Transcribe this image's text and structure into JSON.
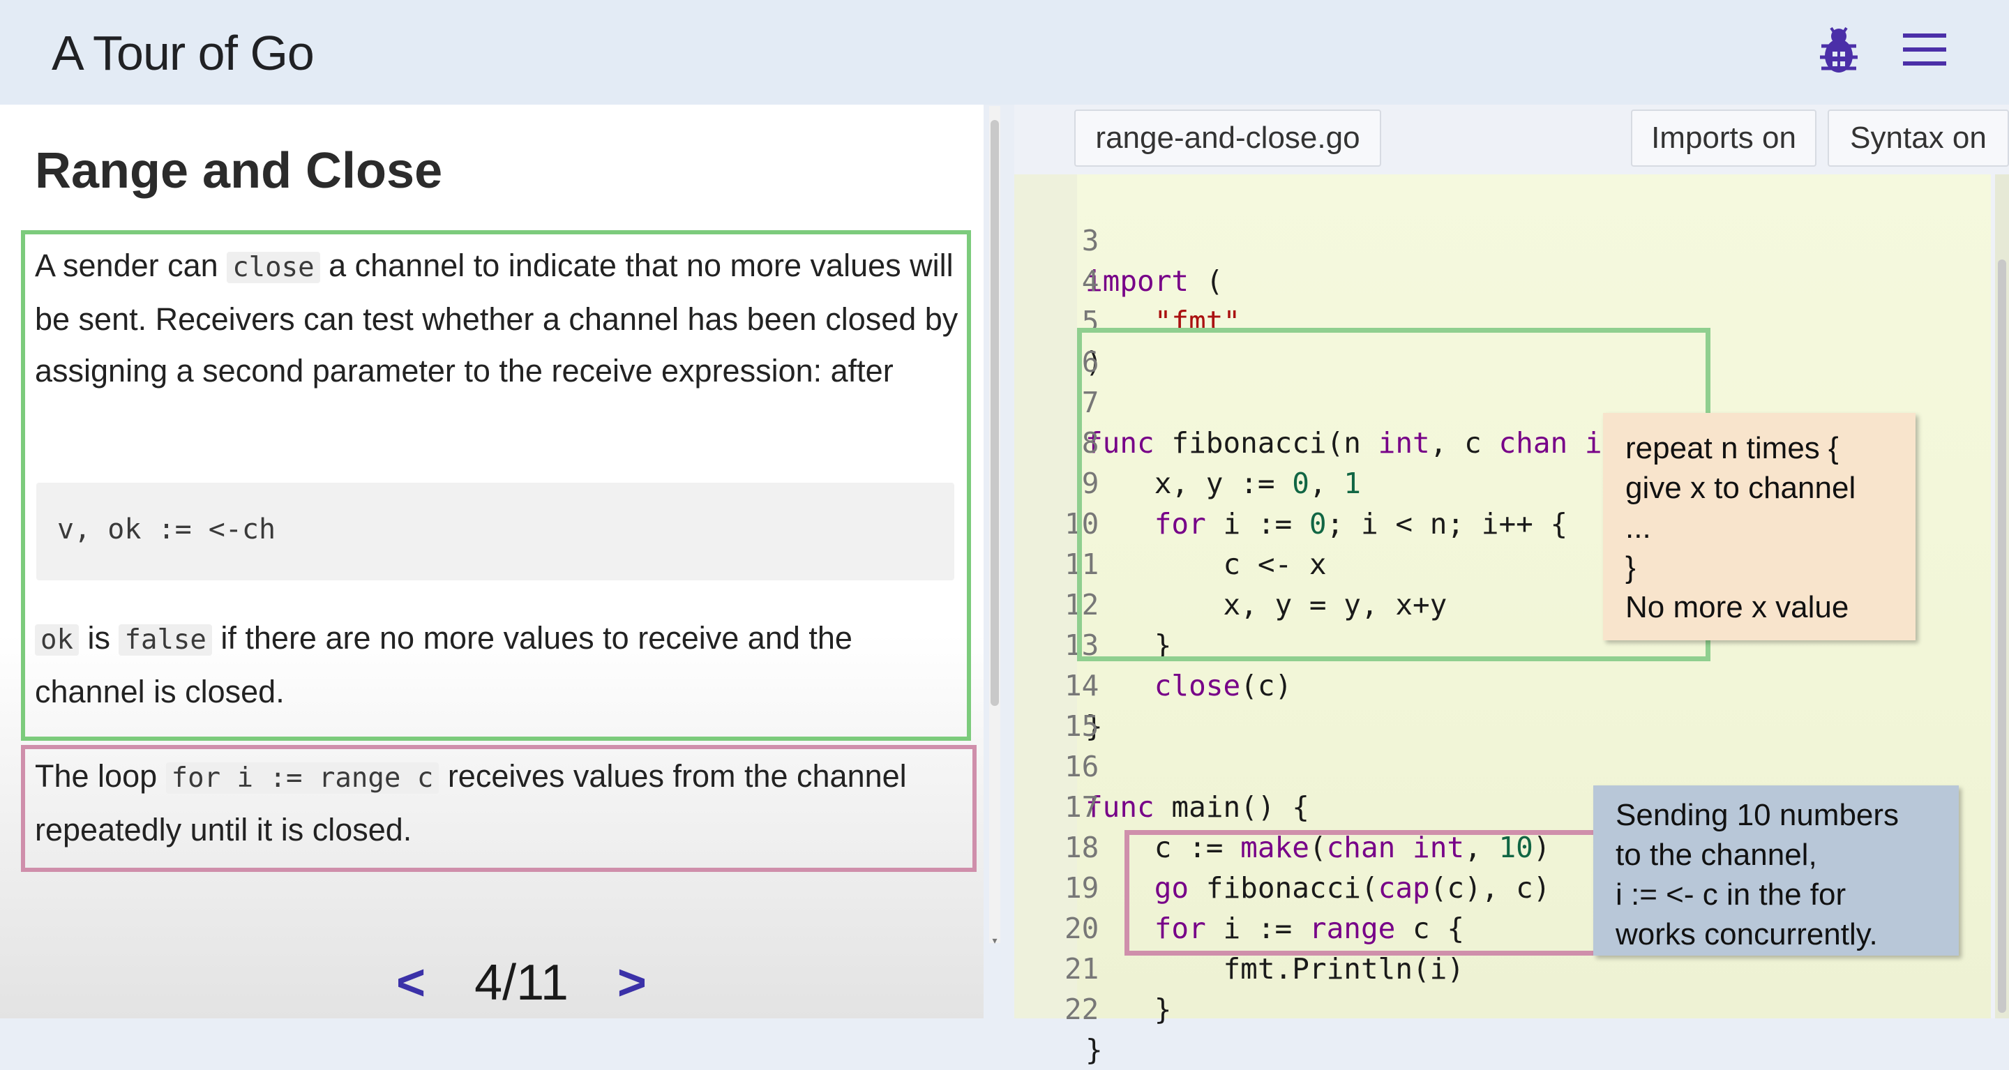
{
  "header": {
    "title": "A Tour of Go",
    "icons": [
      "bug-icon",
      "menu-icon"
    ],
    "accent_color": "#3b31a8"
  },
  "lesson": {
    "title": "Range and Close",
    "p1": {
      "t1": "A sender can ",
      "c1": "close",
      "t2": " a channel to indicate that no more values will be sent. Receivers can test whether a channel has been closed by assigning a second parameter to the receive expression: after"
    },
    "code_block": "v, ok := <-ch",
    "p2": {
      "c1": "ok",
      "t1": " is ",
      "c2": "false",
      "t2": " if there are no more values to receive and the channel is closed."
    },
    "p3": {
      "t1": "The loop ",
      "c1": "for i := range c",
      "t2": " receives values from the channel repeatedly until it is closed."
    }
  },
  "pager": {
    "prev": "<",
    "label": "4/11",
    "next": ">"
  },
  "editor": {
    "file_tab": "range-and-close.go",
    "imports_button": "Imports on",
    "syntax_button": "Syntax on"
  },
  "code": {
    "l3": {
      "n": "3",
      "a": "import",
      "b": " ("
    },
    "l4": {
      "n": "4",
      "a": "    ",
      "b": "\"fmt\""
    },
    "l5": {
      "n": "5",
      "a": ")"
    },
    "l6": {
      "n": "6"
    },
    "l7": {
      "n": "7",
      "a": "func",
      "b": " fibonacci(n ",
      "c": "int",
      "d": ", c ",
      "e": "chan",
      "f": " ",
      "g": "int",
      "h": ") {"
    },
    "l8": {
      "n": "8",
      "a": "    x, y := ",
      "b": "0",
      "c": ", ",
      "d": "1"
    },
    "l9": {
      "n": "9",
      "a": "    ",
      "b": "for",
      "c": " i := ",
      "d": "0",
      "e": "; i < n; i++ {"
    },
    "l10": {
      "n": "10",
      "a": "        c <- x"
    },
    "l11": {
      "n": "11",
      "a": "        x, y = y, x+y"
    },
    "l12": {
      "n": "12",
      "a": "    }"
    },
    "l13": {
      "n": "13",
      "a": "    ",
      "b": "close",
      "c": "(c)"
    },
    "l14": {
      "n": "14",
      "a": "}"
    },
    "l15": {
      "n": "15"
    },
    "l16": {
      "n": "16",
      "a": "func",
      "b": " main() {"
    },
    "l17": {
      "n": "17",
      "a": "    c := ",
      "b": "make",
      "c": "(",
      "d": "chan",
      "e": " ",
      "f": "int",
      "g": ", ",
      "h": "10",
      "i": ")"
    },
    "l18": {
      "n": "18",
      "a": "    ",
      "b": "go",
      "c": " fibonacci(",
      "d": "cap",
      "e": "(c), c)"
    },
    "l19": {
      "n": "19",
      "a": "    ",
      "b": "for",
      "c": " i := ",
      "d": "range",
      "e": " c {"
    },
    "l20": {
      "n": "20",
      "a": "        fmt.Println(i)"
    },
    "l21": {
      "n": "21",
      "a": "    }"
    },
    "l22": {
      "n": "22",
      "a": "}"
    }
  },
  "annotations": {
    "orange_note": [
      "repeat n times {",
      "give x to channel",
      "...",
      "}",
      "No more x value"
    ],
    "blue_note": [
      "Sending 10 numbers",
      "to the channel,",
      "i := <- c in the for",
      "works concurrently."
    ]
  },
  "colors": {
    "green_highlight": "#7ccb7c",
    "pink_highlight": "#cf8fab",
    "orange_note": "#f8e4cc",
    "blue_note": "#b8c7d8",
    "editor_bg": "#f5f9de"
  }
}
